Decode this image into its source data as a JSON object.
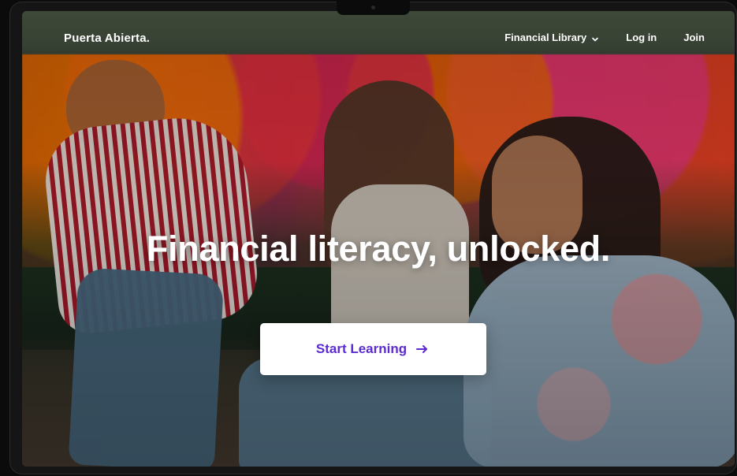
{
  "site": {
    "brand": "Puerta Abierta."
  },
  "nav": {
    "items": [
      {
        "label": "Financial Library",
        "icon": "chevron-down-icon"
      },
      {
        "label": "Log in"
      },
      {
        "label": "Join"
      }
    ]
  },
  "hero": {
    "title": "Financial literacy, unlocked.",
    "cta_label": "Start Learning",
    "cta_icon": "arrow-right-icon"
  },
  "colors": {
    "accent": "#5b2bd1",
    "text_on_image": "#ffffff",
    "button_bg": "#ffffff"
  }
}
